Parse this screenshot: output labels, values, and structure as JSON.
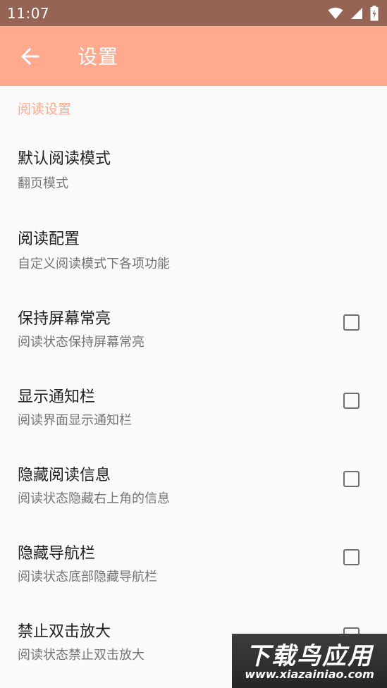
{
  "status_bar": {
    "time": "11:07",
    "icons": [
      "wifi-icon",
      "signal-icon",
      "battery-icon"
    ]
  },
  "toolbar": {
    "back_icon": "arrow-back-icon",
    "title": "设置",
    "background": "#ffa98f"
  },
  "section": {
    "header": "阅读设置"
  },
  "items": [
    {
      "title": "默认阅读模式",
      "summary": "翻页模式"
    },
    {
      "title": "阅读配置",
      "summary": "自定义阅读模式下各项功能"
    },
    {
      "title": "保持屏幕常亮",
      "summary": "阅读状态保持屏幕常亮",
      "checked": false
    },
    {
      "title": "显示通知栏",
      "summary": "阅读界面显示通知栏",
      "checked": false
    },
    {
      "title": "隐藏阅读信息",
      "summary": "阅读状态隐藏右上角的信息",
      "checked": false
    },
    {
      "title": "隐藏导航栏",
      "summary": "阅读状态底部隐藏导航栏",
      "checked": false
    },
    {
      "title": "禁止双击放大",
      "summary": "阅读状态禁止双击放大",
      "checked": false
    }
  ],
  "watermark": {
    "text": "下载鸟应用",
    "url": "www.xiazainiao.com"
  }
}
